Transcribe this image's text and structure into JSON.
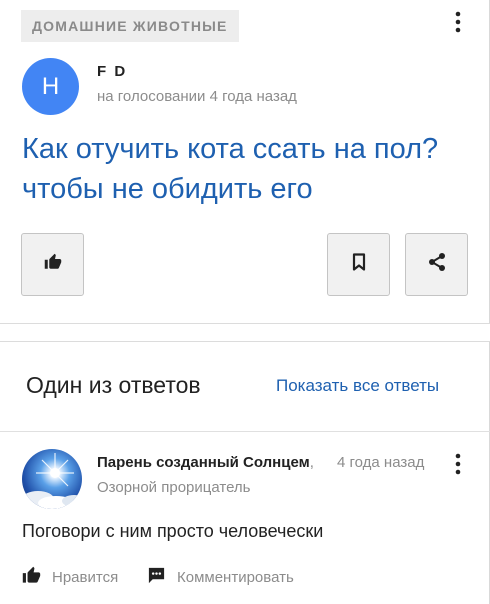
{
  "question": {
    "category": "ДОМАШНИЕ ЖИВОТНЫЕ",
    "author": {
      "initial": "H",
      "name": "F D",
      "meta": "на голосовании 4 года назад",
      "avatar_color": "#4285f4"
    },
    "title": "Как отучить кота ссать на пол? чтобы не обидить его",
    "icons": {
      "like": "thumbs-up-icon",
      "bookmark": "bookmark-icon",
      "share": "share-icon",
      "menu": "vertical-dots-icon"
    }
  },
  "answers": {
    "heading": "Один из ответов",
    "show_all": "Показать все ответы",
    "answer": {
      "author_name": "Парень созданный Солнцем",
      "comma": ",",
      "time": "4 года назад",
      "rank": "Озорной прорицатель",
      "text": "Поговори с ним просто человечески",
      "like_label": "Нравится",
      "comment_label": "Комментировать"
    }
  },
  "colors": {
    "link": "#1e60b0",
    "muted": "#8c8c8c",
    "button_bg": "#f1f1f1"
  }
}
